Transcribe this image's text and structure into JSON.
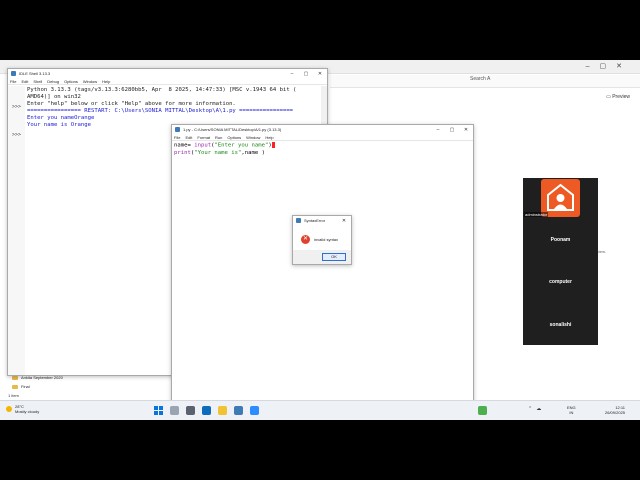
{
  "explorer": {
    "search_placeholder": "Search A",
    "preview_label": "Preview",
    "folders": [
      "Ankita September 2020",
      "Final"
    ],
    "status": "1 item",
    "stray_text": "view."
  },
  "shell": {
    "title": "IDLE Shell 3.13.3",
    "menu": [
      "File",
      "Edit",
      "Shell",
      "Debug",
      "Options",
      "Window",
      "Help"
    ],
    "lines": [
      "Python 3.13.3 (tags/v3.13.3:6280bb5, Apr  8 2025, 14:47:33) [MSC v.1943 64 bit (",
      "AMD64)] on win32",
      "Enter \"help\" below or click \"Help\" above for more information.",
      "",
      "================ RESTART: C:\\Users\\SONIA MITTAL\\Desktop\\A\\1.py ================",
      "Enter you nameOrange",
      "Your name is Orange"
    ],
    "prompt": ">>>"
  },
  "editor": {
    "title": "1.py - C:/Users/SONIA MITTAL/Desktop/A/1.py (3.13.3)",
    "menu": [
      "File",
      "Edit",
      "Format",
      "Run",
      "Options",
      "Window",
      "Help"
    ],
    "line1_a": "name= ",
    "line1_fn": "input",
    "line1_b": "(",
    "line1_str": "\"Enter you name\"",
    "line1_c": ")",
    "line2_fn": "print",
    "line2_b": "(",
    "line2_str": "\"Your name is\"",
    "line2_c": ",name )"
  },
  "dialog": {
    "title": "SyntaxError",
    "message": "invalid syntax",
    "ok_label": "OK",
    "error_glyph": "✕"
  },
  "participants": {
    "admin_label": "adminstrator",
    "names": [
      "Poonam",
      "computer",
      "sonalishi"
    ],
    "avatar_color": "#ee5a24"
  },
  "taskbar": {
    "temperature": "28°C",
    "condition": "Mostly cloudy",
    "lang_top": "ENG",
    "lang_bottom": "IN",
    "time": "12:11",
    "date": "26/09/2025"
  }
}
